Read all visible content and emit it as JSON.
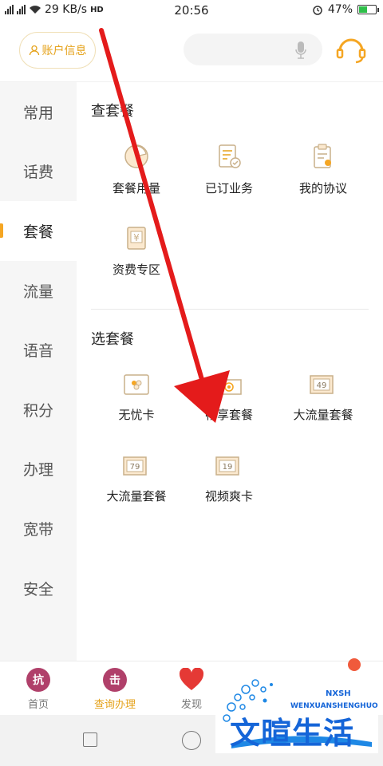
{
  "status_bar": {
    "network": "4G",
    "speed": "29 KB/s",
    "hd": "HD",
    "time": "20:56",
    "battery": "47%",
    "battery_level": 0.47
  },
  "header": {
    "account_label": "账户信息",
    "search_placeholder": ""
  },
  "sidebar": {
    "items": [
      {
        "label": "常用"
      },
      {
        "label": "话费"
      },
      {
        "label": "套餐"
      },
      {
        "label": "流量"
      },
      {
        "label": "语音"
      },
      {
        "label": "积分"
      },
      {
        "label": "办理"
      },
      {
        "label": "宽带"
      },
      {
        "label": "安全"
      }
    ],
    "active_index": 2
  },
  "content": {
    "section1": {
      "title": "查套餐",
      "items": [
        {
          "label": "套餐用量",
          "icon": "usage-gauge-icon"
        },
        {
          "label": "已订业务",
          "icon": "subscribed-doc-icon"
        },
        {
          "label": "我的协议",
          "icon": "clipboard-icon"
        },
        {
          "label": "资费专区",
          "icon": "yuan-book-icon"
        }
      ]
    },
    "section2": {
      "title": "选套餐",
      "items": [
        {
          "label": "无忧卡",
          "icon": "sim-card-icon",
          "num": ""
        },
        {
          "label": "畅享套餐",
          "icon": "folder-swirl-icon",
          "num": ""
        },
        {
          "label": "大流量套餐",
          "icon": "plan-49-icon",
          "num": "49"
        },
        {
          "label": "大流量套餐",
          "icon": "plan-79-icon",
          "num": "79"
        },
        {
          "label": "视频爽卡",
          "icon": "plan-19-icon",
          "num": "19"
        }
      ]
    }
  },
  "tabbar": {
    "tabs": [
      {
        "label": "首页",
        "glyph": "抗",
        "color": "#b0406a"
      },
      {
        "label": "查询办理",
        "glyph": "击",
        "color": "#b0406a"
      },
      {
        "label": "发现",
        "glyph": "",
        "color": "#e53935"
      }
    ],
    "active_index": 1
  },
  "watermark": {
    "brand_cn": "文暄生活",
    "brand_pinyin": "WENXUANSHENGHUO",
    "brand_abbr": "NXSH"
  },
  "colors": {
    "accent": "#f5a623",
    "accent_text": "#e5a21a",
    "sidebar_bg": "#f6f6f6",
    "arrow": "#e41b1b",
    "watermark": "#1565d8"
  }
}
